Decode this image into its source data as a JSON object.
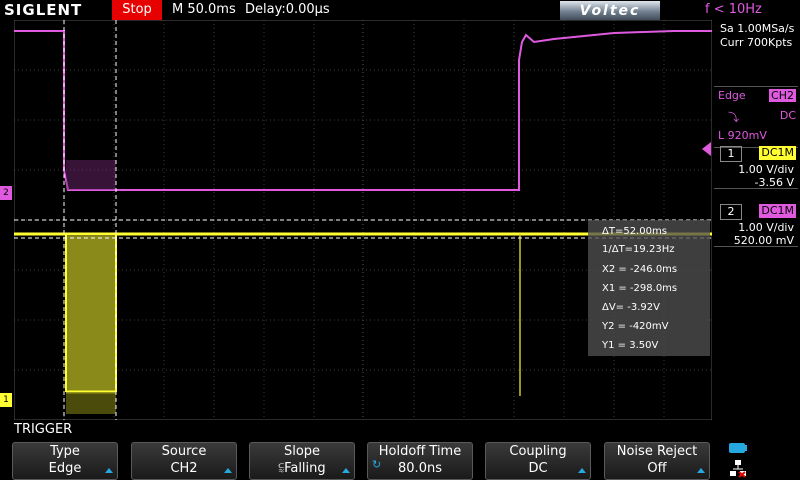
{
  "header": {
    "brand_logo": "SIGLENT",
    "run_state": "Stop",
    "timebase": "M 50.0ms",
    "delay": "Delay:0.00µs",
    "vendor_badge": "Voltec",
    "frequency": "f < 10Hz"
  },
  "acquisition": {
    "sample_rate": "Sa 1.00MSa/s",
    "memory": "Curr 700Kpts"
  },
  "trigger_info": {
    "type": "Edge",
    "source": "CH2",
    "slope_icon": "falling-edge-icon",
    "coupling": "DC",
    "level": "L  920mV"
  },
  "channels": [
    {
      "number": "1",
      "coupling": "DC1M",
      "volts_div": "1.00 V/div",
      "offset": "-3.56 V",
      "color": "#ffff33"
    },
    {
      "number": "2",
      "coupling": "DC1M",
      "volts_div": "1.00 V/div",
      "offset": "520.00 mV",
      "color": "#e05ae0"
    }
  ],
  "cursor_measurements": [
    "ΔT=52.00ms",
    "1/ΔT=19.23Hz",
    "X2 = -246.0ms",
    "X1 = -298.0ms",
    "ΔV= -3.92V",
    "Y2 = -420mV",
    "Y1 = 3.50V"
  ],
  "channel_markers": {
    "ch1": "1",
    "ch2": "2"
  },
  "menu": {
    "title": "TRIGGER",
    "buttons": [
      {
        "label": "Type",
        "value": "Edge"
      },
      {
        "label": "Source",
        "value": "CH2"
      },
      {
        "label": "Slope",
        "value": "⫉Falling"
      },
      {
        "label": "Holdoff Time",
        "value": "80.0ns"
      },
      {
        "label": "Coupling",
        "value": "DC"
      },
      {
        "label": "Noise Reject",
        "value": "Off"
      }
    ]
  },
  "colors": {
    "ch1": "#ffff33",
    "ch2": "#e05ae0",
    "accent": "#26a9e0",
    "stop": "#e60000"
  }
}
